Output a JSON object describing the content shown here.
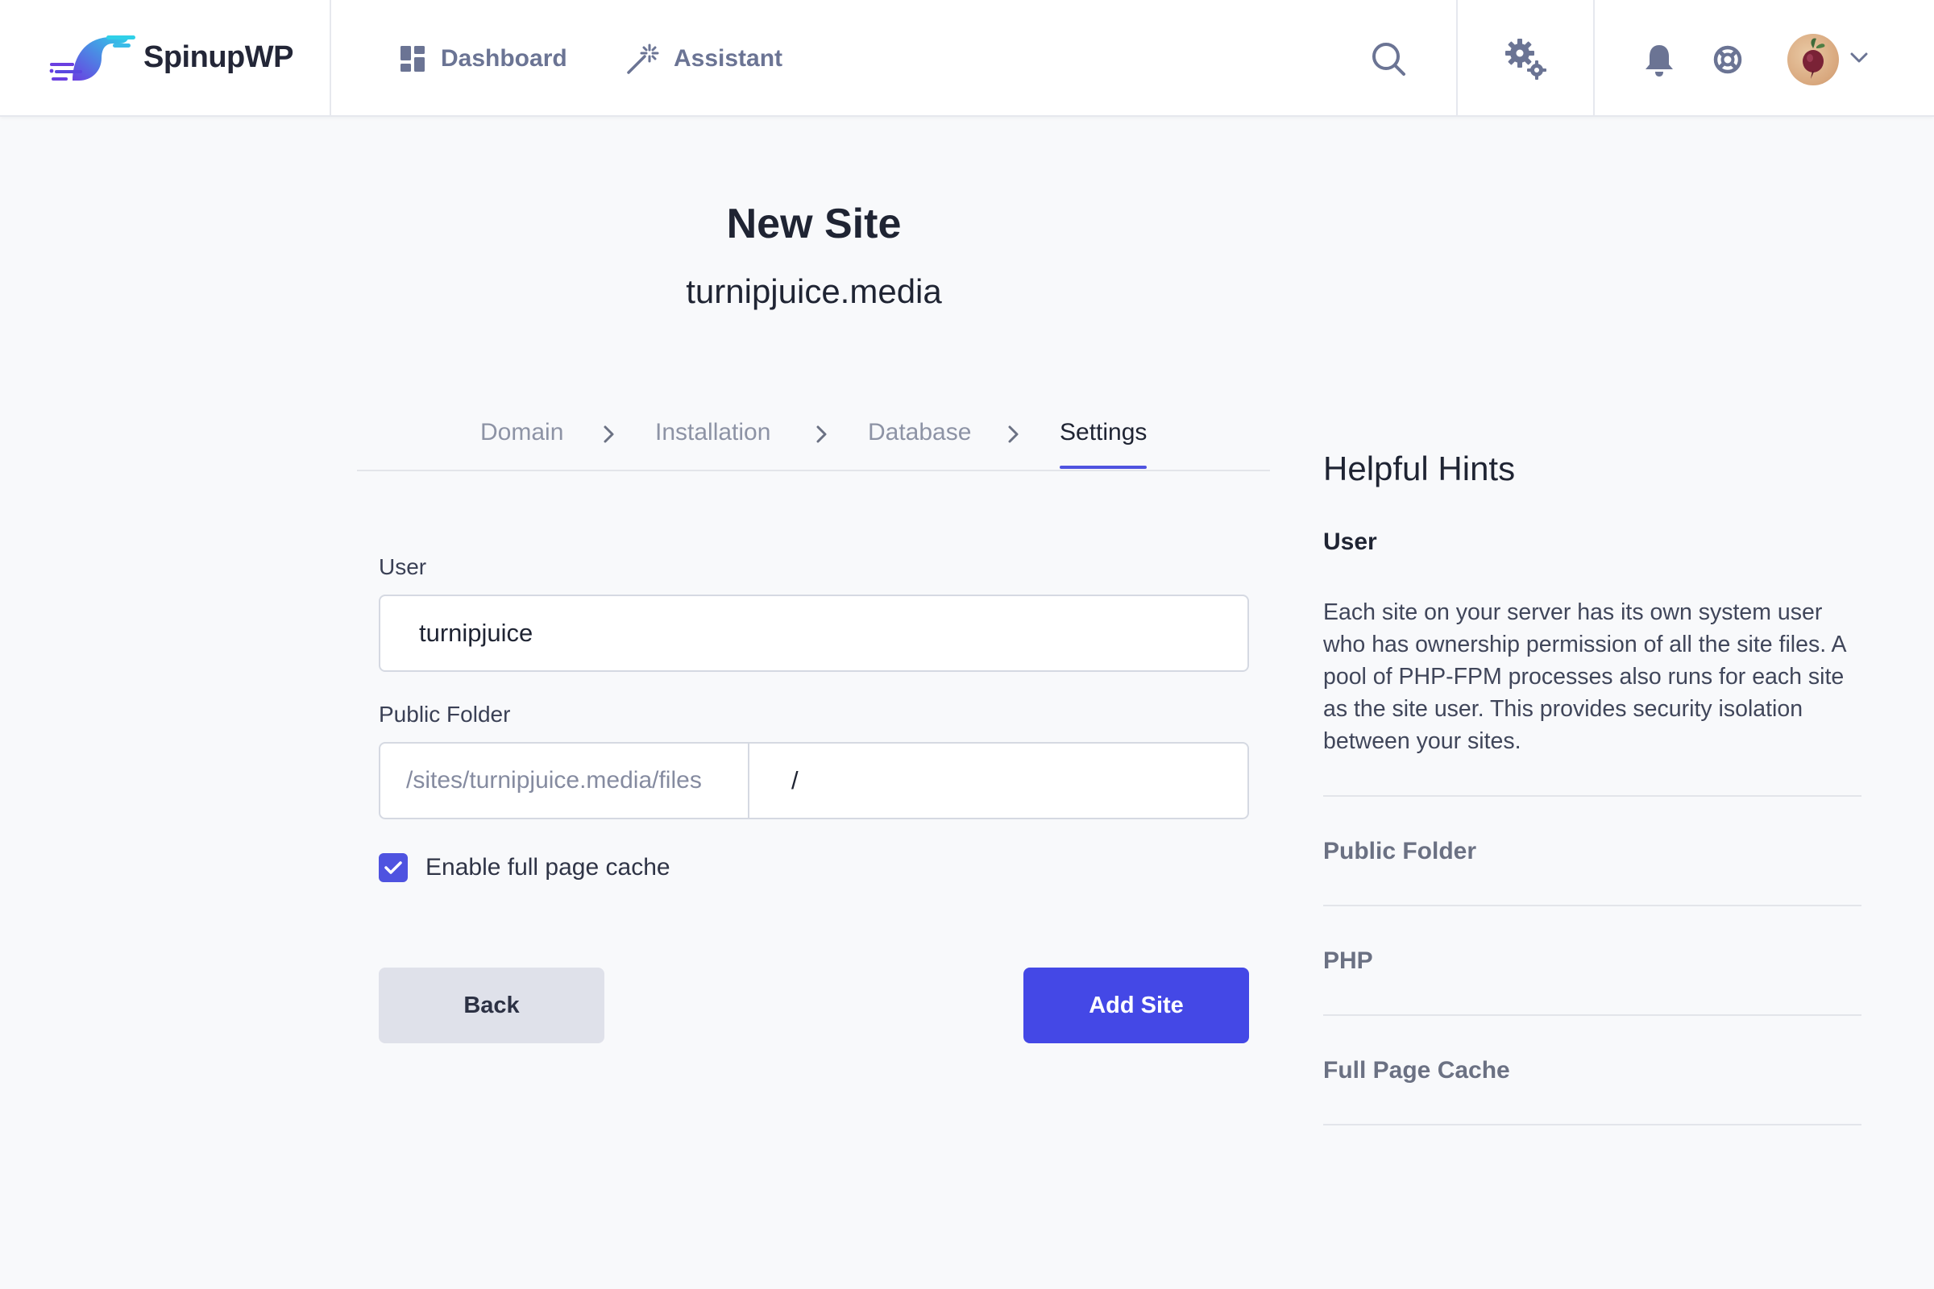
{
  "app": {
    "brand": "SpinupWP"
  },
  "nav": {
    "dashboard": "Dashboard",
    "assistant": "Assistant"
  },
  "topbar_icons": [
    "search-icon",
    "gears-icon",
    "bell-icon",
    "lifebuoy-icon",
    "avatar",
    "chevron-down-icon"
  ],
  "page": {
    "title": "New Site",
    "subtitle": "turnipjuice.media"
  },
  "steps": [
    {
      "label": "Domain",
      "active": false
    },
    {
      "label": "Installation",
      "active": false
    },
    {
      "label": "Database",
      "active": false
    },
    {
      "label": "Settings",
      "active": true
    }
  ],
  "form": {
    "user_label": "User",
    "user_value": "turnipjuice",
    "folder_label": "Public Folder",
    "folder_prefix": "/sites/turnipjuice.media/files",
    "folder_value": "/",
    "cache_label": "Enable full page cache",
    "cache_checked": true,
    "back_label": "Back",
    "add_label": "Add Site"
  },
  "hints": {
    "title": "Helpful Hints",
    "user_heading": "User",
    "user_text": "Each site on your server has its own system user who has ownership permission of all the site files. A pool of PHP-FPM processes also runs for each site as the site user. This provides security isolation between your sites.",
    "sections": [
      "Public Folder",
      "PHP",
      "Full Page Cache"
    ]
  },
  "colors": {
    "accent": "#4448e6",
    "background": "#f8f9fb",
    "nav_text": "#6b7494"
  }
}
